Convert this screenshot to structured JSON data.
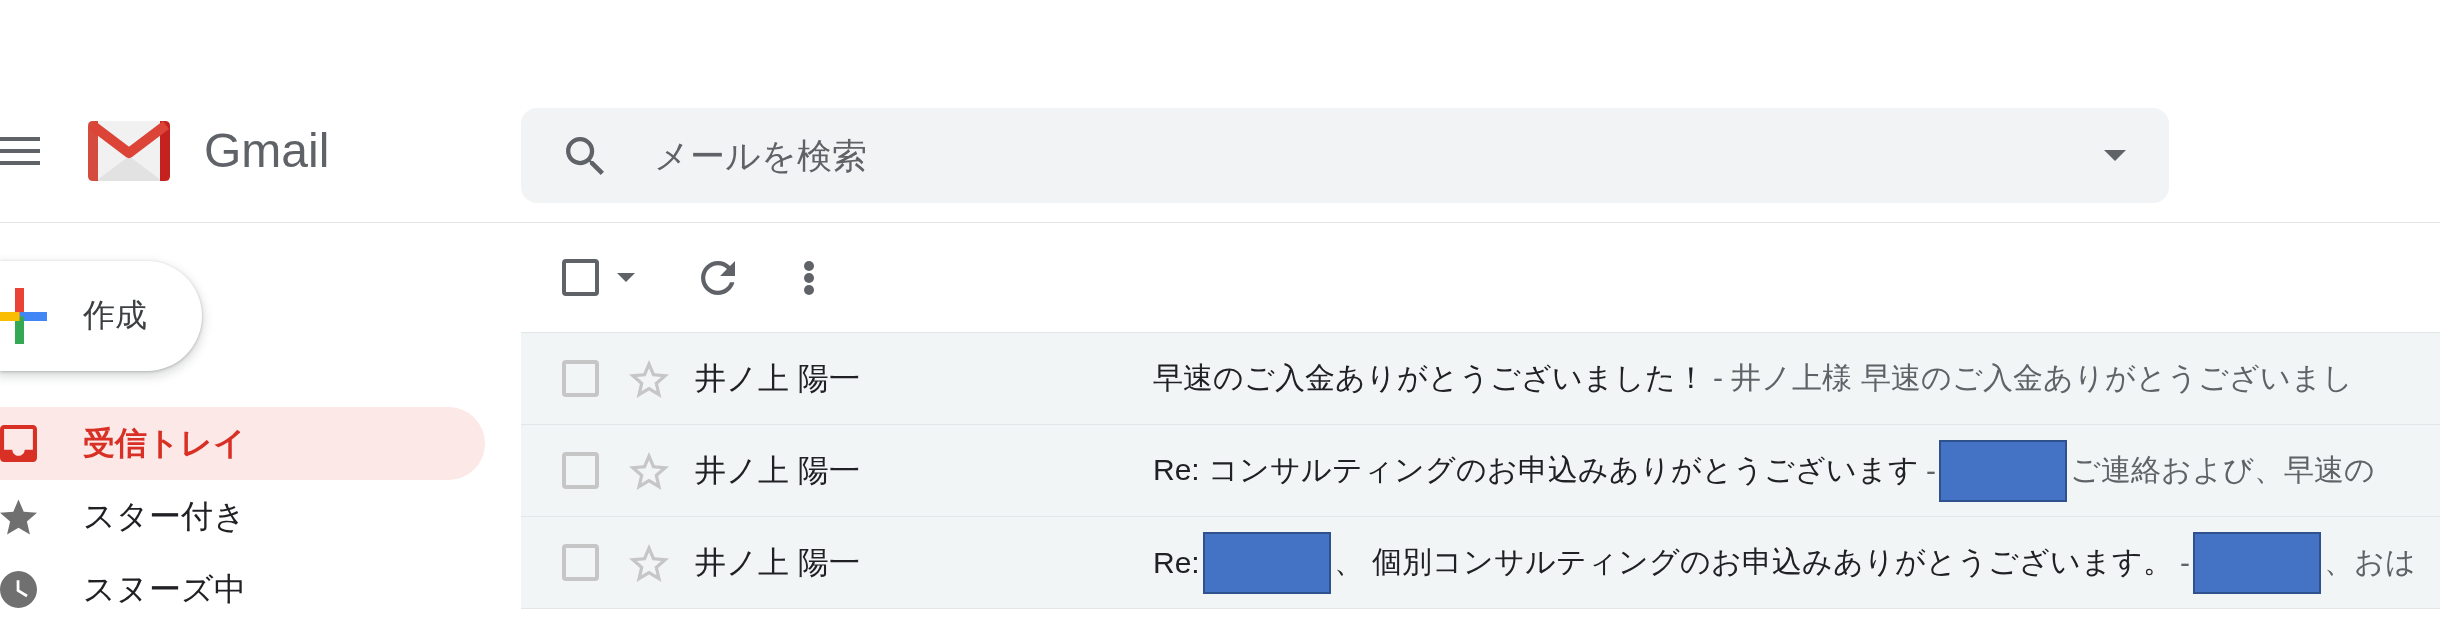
{
  "header": {
    "app_name": "Gmail",
    "search": {
      "placeholder": "メールを検索"
    }
  },
  "sidebar": {
    "compose": {
      "label": "作成"
    },
    "items": [
      {
        "label": "受信トレイ",
        "selected": true
      },
      {
        "label": "スター付き",
        "selected": false
      },
      {
        "label": "スヌーズ中",
        "selected": false
      }
    ]
  },
  "toolbar": {
    "select_all": {
      "checked": false
    }
  },
  "emails": [
    {
      "sender": "井ノ上 陽一",
      "checked": false,
      "starred": false,
      "unread": false,
      "parts": [
        {
          "kind": "subject",
          "text": "早速のご入金ありがとうございました！"
        },
        {
          "kind": "snippet",
          "text": "- 井ノ上様 早速のご入金ありがとうございまし"
        }
      ]
    },
    {
      "sender": "井ノ上 陽一",
      "checked": false,
      "starred": false,
      "unread": false,
      "parts": [
        {
          "kind": "subject",
          "text": "Re: コンサルティングのお申込みありがとうございます"
        },
        {
          "kind": "snippet",
          "text": "-"
        },
        {
          "kind": "redaction"
        },
        {
          "kind": "snippet",
          "text": "ご連絡および、早速の"
        }
      ]
    },
    {
      "sender": "井ノ上 陽一",
      "checked": false,
      "starred": false,
      "unread": false,
      "parts": [
        {
          "kind": "subject",
          "text": "Re:"
        },
        {
          "kind": "redaction"
        },
        {
          "kind": "subject",
          "text": "、 個別コンサルティングのお申込みありがとうございます。"
        },
        {
          "kind": "snippet",
          "text": "-"
        },
        {
          "kind": "redaction"
        },
        {
          "kind": "snippet",
          "text": "、おは"
        }
      ]
    }
  ]
}
